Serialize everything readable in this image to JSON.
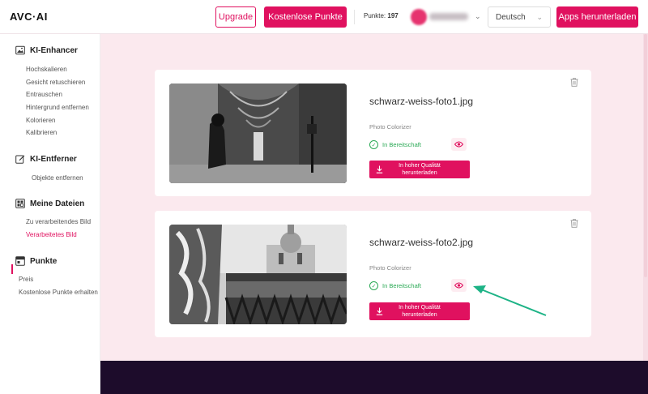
{
  "header": {
    "logo": "AVC·AI",
    "upgrade_label": "Upgrade",
    "free_points_label": "Kostenlose Punkte",
    "points_label": "Punkte:",
    "points_value": "197",
    "language": "Deutsch",
    "apps_label": "Apps herunterladen",
    "accent": "#e0115f"
  },
  "sidebar": {
    "sections": [
      {
        "title": "KI-Enhancer",
        "icon": "image-enhance-icon",
        "items": [
          "Hochskalieren",
          "Gesicht retuschieren",
          "Entrauschen",
          "Hintergrund entfernen",
          "Kolorieren",
          "Kalibrieren"
        ]
      },
      {
        "title": "KI-Entferner",
        "icon": "edit-icon",
        "items": [
          "Objekte entfernen"
        ]
      },
      {
        "title": "Meine Dateien",
        "icon": "files-icon",
        "items": [
          "Zu verarbeitendes Bild",
          "Verarbeitetes Bild"
        ]
      },
      {
        "title": "Punkte",
        "icon": "points-icon",
        "items": [
          "Preis",
          "Kostenlose Punkte erhalten"
        ]
      }
    ],
    "active_item": "Verarbeitetes Bild"
  },
  "files": [
    {
      "name": "schwarz-weiss-foto1.jpg",
      "tool": "Photo Colorizer",
      "status": "In Bereitschaft",
      "download_label_1": "In hoher Qualität",
      "download_label_2": "herunterladen"
    },
    {
      "name": "schwarz-weiss-foto2.jpg",
      "tool": "Photo Colorizer",
      "status": "In Bereitschaft",
      "download_label_1": "In hoher Qualität",
      "download_label_2": "herunterladen"
    }
  ],
  "annotation": {
    "color": "#1db386",
    "icon": "arrow-annotation"
  }
}
